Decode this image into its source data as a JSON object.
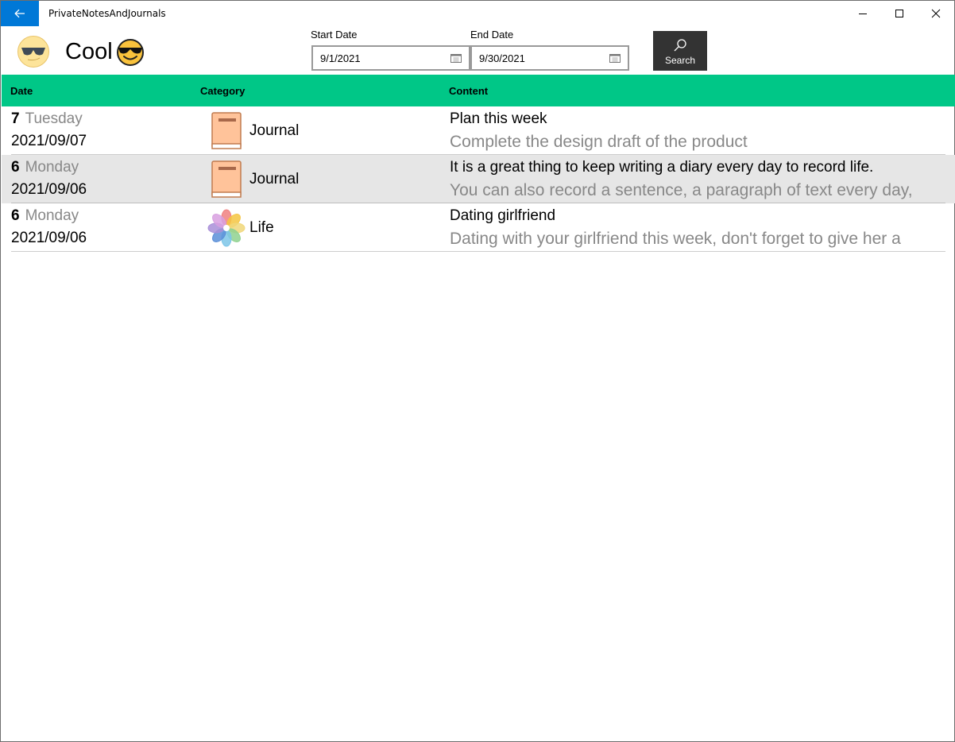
{
  "window": {
    "title": "PrivateNotesAndJournals",
    "accent": "#0078d7",
    "controls": {
      "minimize": "minimize-icon",
      "maximize": "maximize-icon",
      "close": "close-icon"
    }
  },
  "header": {
    "user_name": "Cool",
    "avatar_icon": "sunglasses-face-icon",
    "name_emoji": "smiling-face-with-sunglasses-icon",
    "start_date": {
      "label": "Start Date",
      "value": "9/1/2021"
    },
    "end_date": {
      "label": "End Date",
      "value": "9/30/2021"
    },
    "search_label": "Search"
  },
  "grid": {
    "header_color": "#00c787",
    "columns": [
      "Date",
      "Category",
      "Content"
    ],
    "rows": [
      {
        "day": "7",
        "weekday": "Tuesday",
        "date": "2021/09/07",
        "category": "Journal",
        "category_icon": "book-icon",
        "title": "Plan this week",
        "body": "Complete the design draft of the product",
        "selected": false
      },
      {
        "day": "6",
        "weekday": "Monday",
        "date": "2021/09/06",
        "category": "Journal",
        "category_icon": "book-icon",
        "title": "It is a great thing to keep writing a diary every day to record life.",
        "body": "You can also record a sentence, a paragraph of text every day,",
        "selected": true
      },
      {
        "day": "6",
        "weekday": "Monday",
        "date": "2021/09/06",
        "category": "Life",
        "category_icon": "flower-icon",
        "title": "Dating girlfriend",
        "body": "Dating with your girlfriend this week, don't forget to give her a",
        "selected": false
      }
    ]
  }
}
